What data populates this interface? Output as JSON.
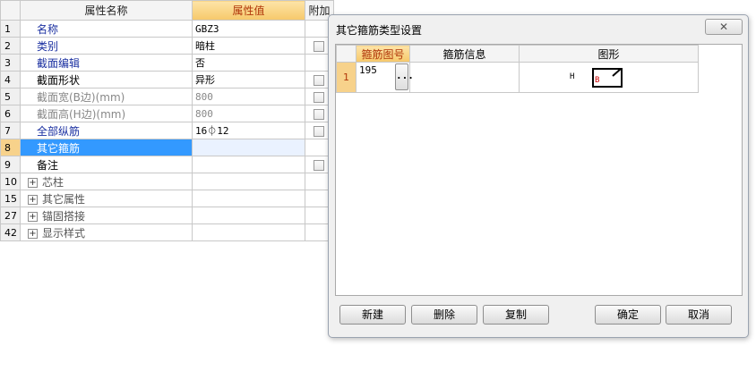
{
  "grid": {
    "headers": {
      "name": "属性名称",
      "value": "属性值",
      "extra": "附加"
    },
    "rows": [
      {
        "num": "1",
        "name": "名称",
        "value": "GBZ3"
      },
      {
        "num": "2",
        "name": "类别",
        "value": "暗柱"
      },
      {
        "num": "3",
        "name": "截面编辑",
        "value": "否"
      },
      {
        "num": "4",
        "name": "截面形状",
        "value": "异形"
      },
      {
        "num": "5",
        "name": "截面宽(B边)(mm)",
        "value": "800"
      },
      {
        "num": "6",
        "name": "截面高(H边)(mm)",
        "value": "800"
      },
      {
        "num": "7",
        "name": "全部纵筋",
        "value": "16⏀12"
      },
      {
        "num": "8",
        "name": "其它箍筋",
        "value": ""
      },
      {
        "num": "9",
        "name": "备注",
        "value": ""
      },
      {
        "num": "10",
        "name": "芯柱",
        "value": ""
      },
      {
        "num": "15",
        "name": "其它属性",
        "value": ""
      },
      {
        "num": "27",
        "name": "锚固搭接",
        "value": ""
      },
      {
        "num": "42",
        "name": "显示样式",
        "value": ""
      }
    ]
  },
  "dialog": {
    "title": "其它箍筋类型设置",
    "close_label": "✕",
    "columns": {
      "code": "箍筋图号",
      "info": "箍筋信息",
      "shape": "图形"
    },
    "rows": [
      {
        "num": "1",
        "code": "195",
        "dots": "...",
        "info": "",
        "shape_label_h": "H",
        "shape_label_b": "B"
      }
    ],
    "buttons": {
      "new": "新建",
      "delete": "删除",
      "copy": "复制",
      "ok": "确定",
      "cancel": "取消"
    }
  }
}
